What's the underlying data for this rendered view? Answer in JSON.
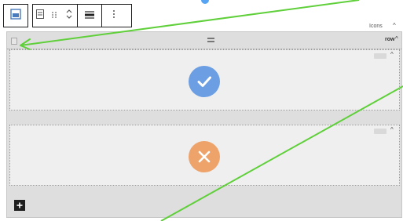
{
  "toolbar": {
    "items": [
      {
        "name": "block-type-icon"
      },
      {
        "name": "grid-icon"
      },
      {
        "name": "drag-handle-icon"
      },
      {
        "name": "move-up-down-icon"
      },
      {
        "name": "align-icon"
      },
      {
        "name": "more-options-icon"
      }
    ]
  },
  "panel": {
    "label": "Icons",
    "caret": "^"
  },
  "row": {
    "label": "row",
    "caret": "^",
    "cells": [
      {
        "icon": "check-circle-icon",
        "color": "#6b9ee2",
        "caret": "^"
      },
      {
        "icon": "close-circle-icon",
        "color": "#eea36a",
        "caret": "^"
      }
    ]
  },
  "add": {
    "label": "+"
  },
  "colors": {
    "arrow": "#5fcf3a",
    "accent": "#56a4f3",
    "check": "#6b9ee2",
    "cross": "#eea36a"
  }
}
